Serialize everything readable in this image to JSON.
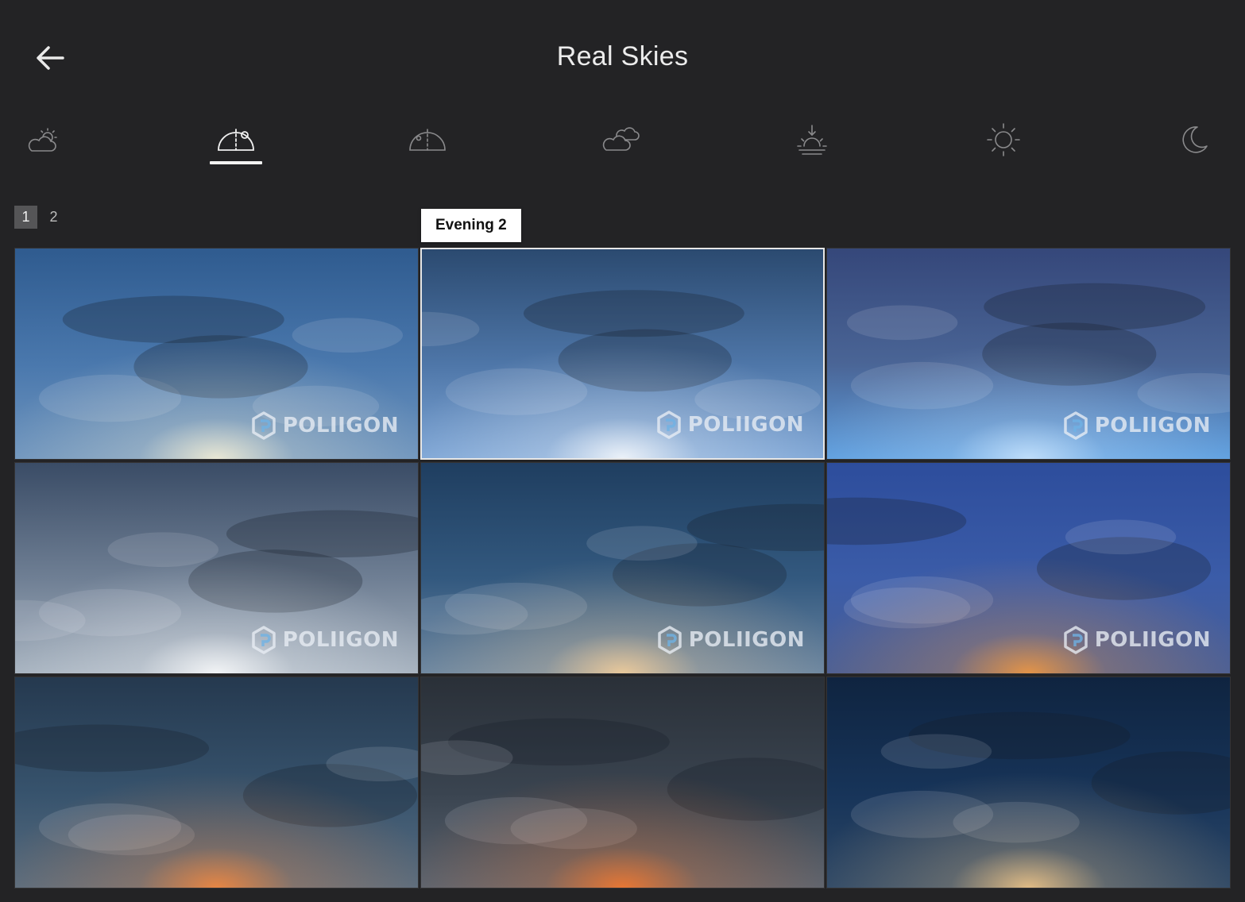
{
  "header": {
    "title": "Real Skies",
    "back_icon": "arrow-left-icon"
  },
  "tabs": [
    {
      "icon": "partly-cloudy-icon",
      "active": false
    },
    {
      "icon": "sky-dome-sun-icon",
      "active": true
    },
    {
      "icon": "sky-dome-icon",
      "active": false
    },
    {
      "icon": "cloudy-icon",
      "active": false
    },
    {
      "icon": "sunset-icon",
      "active": false
    },
    {
      "icon": "sun-icon",
      "active": false
    },
    {
      "icon": "moon-icon",
      "active": false
    }
  ],
  "pagination": {
    "pages": [
      "1",
      "2"
    ],
    "current": "1"
  },
  "tooltip": {
    "text": "Evening 2"
  },
  "grid": {
    "watermark": "POLIIGON",
    "items": [
      {
        "top": "#2f5b8f",
        "mid": "#4a78ad",
        "bottom": "#6f95be",
        "glow": "#fff6d8",
        "hovered": false,
        "watermark": true
      },
      {
        "top": "#2b4a70",
        "mid": "#4e76a8",
        "bottom": "#7ea6d6",
        "glow": "#ffffff",
        "hovered": true,
        "watermark": true
      },
      {
        "top": "#35477a",
        "mid": "#4a6596",
        "bottom": "#5fa0e0",
        "glow": "#cfe8ff",
        "hovered": false,
        "watermark": true
      },
      {
        "top": "#3a4c66",
        "mid": "#6f7f94",
        "bottom": "#a6b2bf",
        "glow": "#ffffff",
        "hovered": false,
        "watermark": true
      },
      {
        "top": "#1f3e60",
        "mid": "#33597f",
        "bottom": "#6b86a1",
        "glow": "#ffd49a",
        "hovered": false,
        "watermark": true
      },
      {
        "top": "#2d4d9c",
        "mid": "#3b5ca8",
        "bottom": "#4a5f96",
        "glow": "#ff9d3a",
        "hovered": false,
        "watermark": true
      },
      {
        "top": "#25394f",
        "mid": "#37536d",
        "bottom": "#5a6d7f",
        "glow": "#ff8a3a",
        "hovered": false,
        "watermark": false
      },
      {
        "top": "#2a3038",
        "mid": "#3a4450",
        "bottom": "#5b6470",
        "glow": "#ff7a2a",
        "hovered": false,
        "watermark": false
      },
      {
        "top": "#0f2440",
        "mid": "#173459",
        "bottom": "#2e4866",
        "glow": "#ffcf8a",
        "hovered": false,
        "watermark": false
      }
    ]
  }
}
